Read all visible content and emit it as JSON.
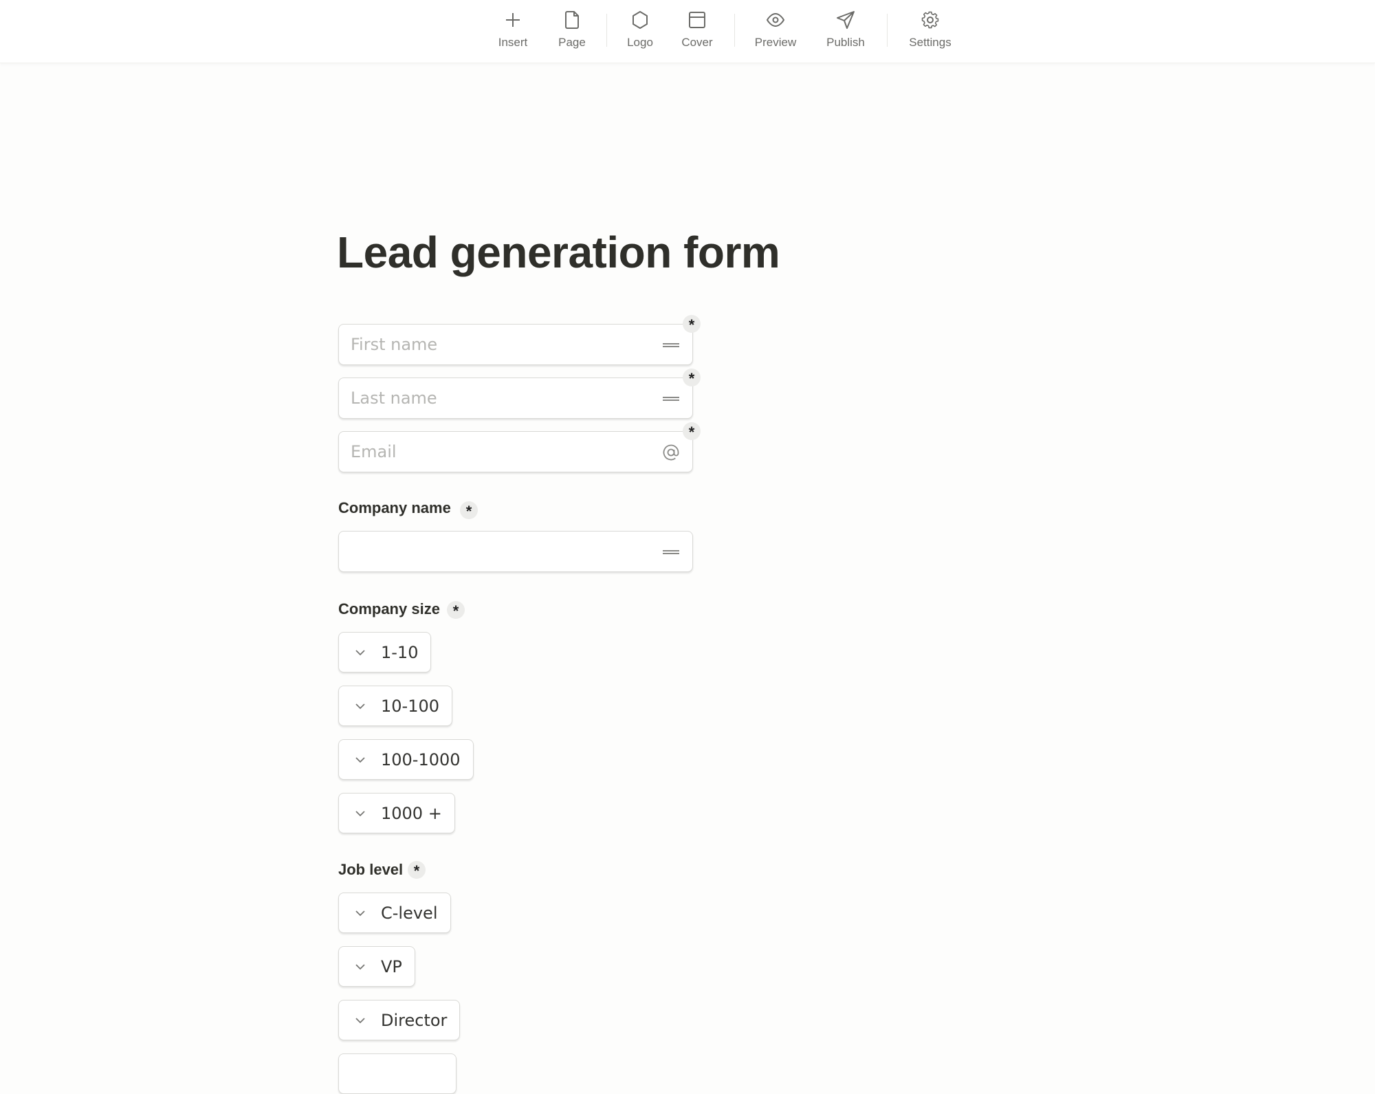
{
  "toolbar": {
    "items": [
      {
        "label": "Insert",
        "icon": "plus-icon"
      },
      {
        "label": "Page",
        "icon": "page-icon"
      },
      {
        "label": "Logo",
        "icon": "hexagon-icon"
      },
      {
        "label": "Cover",
        "icon": "cover-icon"
      },
      {
        "label": "Preview",
        "icon": "eye-icon"
      },
      {
        "label": "Publish",
        "icon": "send-icon"
      },
      {
        "label": "Settings",
        "icon": "gear-icon"
      }
    ]
  },
  "form": {
    "title": "Lead generation form",
    "required_mark": "*",
    "fields": [
      {
        "placeholder": "First name",
        "value": "",
        "icon": "short-text-icon",
        "required": true
      },
      {
        "placeholder": "Last name",
        "value": "",
        "icon": "short-text-icon",
        "required": true
      },
      {
        "placeholder": "Email",
        "value": "",
        "icon": "at-sign-icon",
        "required": true
      }
    ],
    "company_name": {
      "label": "Company name",
      "value": "",
      "icon": "short-text-icon",
      "required": true
    },
    "company_size": {
      "label": "Company size",
      "required": true,
      "options": [
        "1-10",
        "10-100",
        "100-1000",
        "1000 +"
      ]
    },
    "job_level": {
      "label": "Job level",
      "required": true,
      "options": [
        "C-level",
        "VP",
        "Director",
        ""
      ]
    }
  }
}
